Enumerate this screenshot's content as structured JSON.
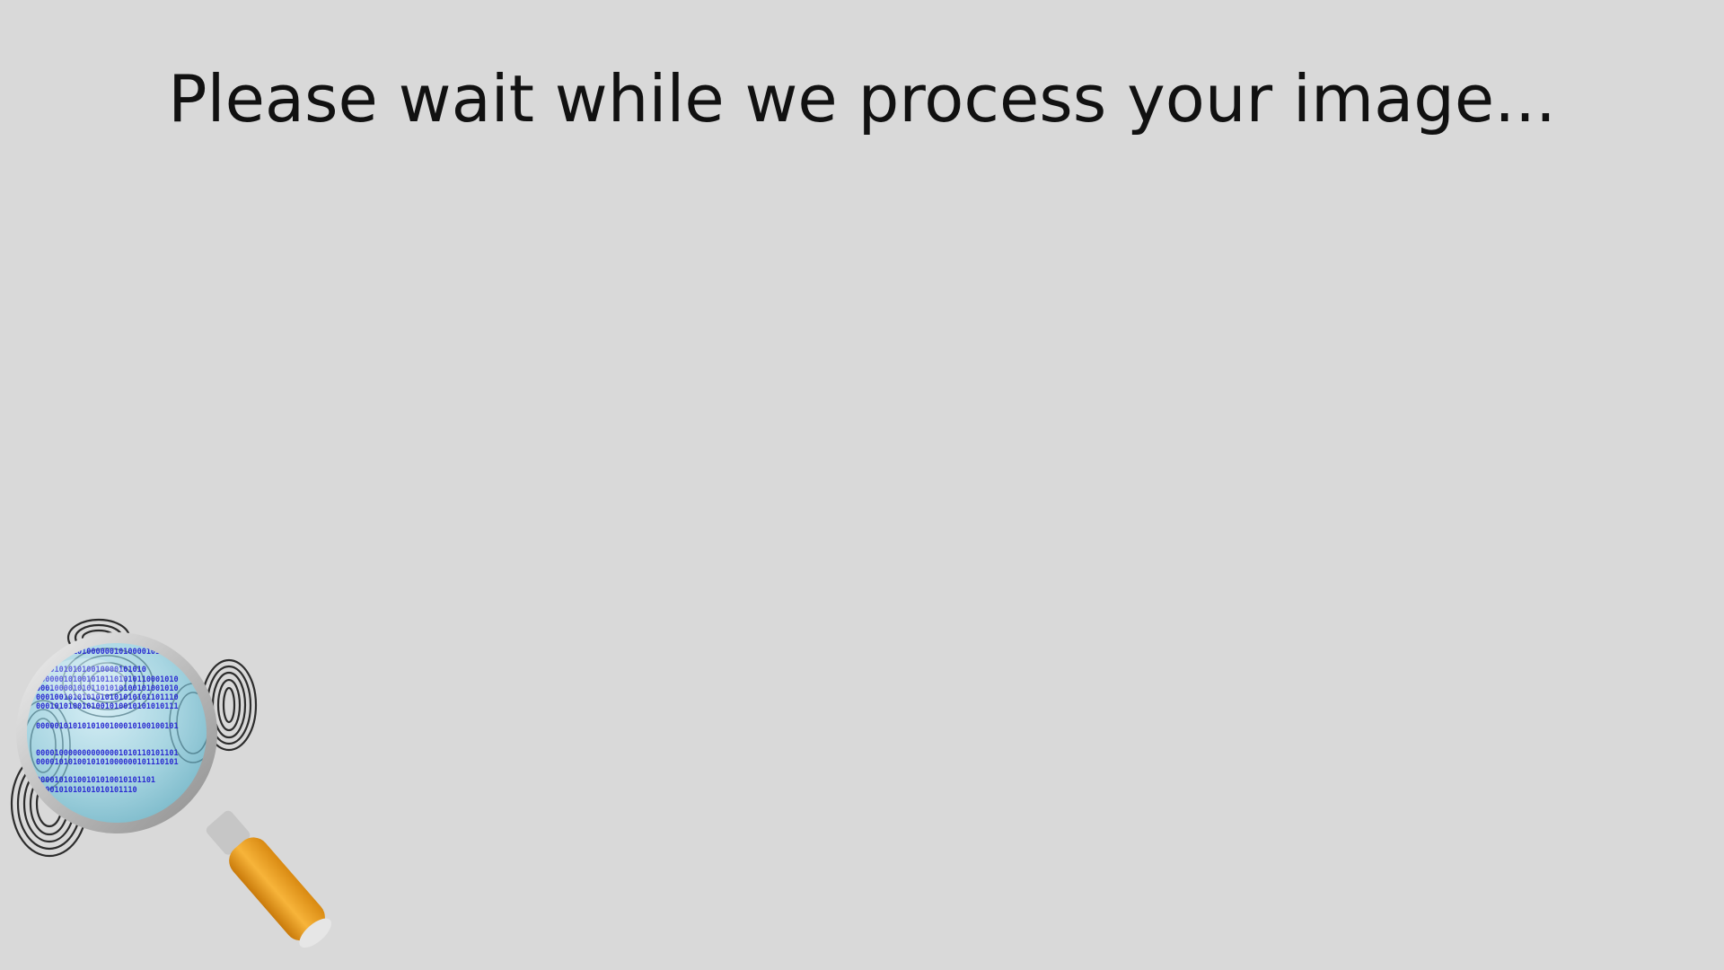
{
  "status": {
    "message": "Please wait while we process your image..."
  },
  "illustration": {
    "icon": "magnifying-glass-fingerprint-icon",
    "binary_lines": [
      "0010001010100000010100001010010",
      "000010101010010000101010",
      "0000001010010101101010110001010",
      "0001000010101101010100101001010",
      "0001001010101010101010101101110",
      "0001010100101001010010101010111",
      "0000010101010100100010100100101",
      "0000100000000000001010110101101",
      "0000101010010101000000101110101",
      "00001010100101010010101101",
      "0000101010101010101110"
    ],
    "colors": {
      "background": "#d9d9d9",
      "lens": "#a9d6e2",
      "binary_text": "#2b2bd1",
      "handle": "#f0a020",
      "rim": "#c8c8c8"
    }
  }
}
